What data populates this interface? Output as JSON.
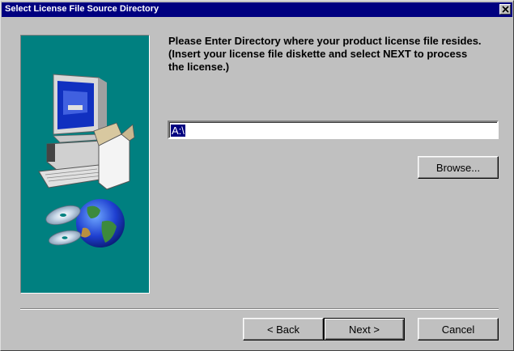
{
  "window": {
    "title": "Select License File Source Directory"
  },
  "instructions": {
    "line1": "Please Enter Directory where your product license file resides.",
    "line2": "(Insert your license file diskette and select NEXT to process",
    "line3": "the license.)"
  },
  "directory": {
    "value": "A:\\"
  },
  "buttons": {
    "browse": "Browse...",
    "back": "< Back",
    "next": "Next >",
    "cancel": "Cancel"
  },
  "colors": {
    "titlebar": "#000080",
    "face": "#c0c0c0",
    "art_background": "#008080"
  },
  "icons": {
    "close": "close-x-icon",
    "art": "computer-globe-cd-illustration"
  }
}
